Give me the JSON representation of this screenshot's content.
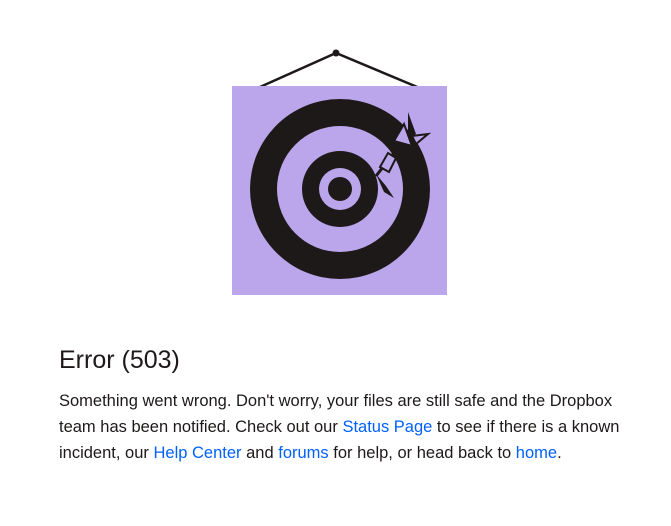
{
  "illustration": {
    "name": "hanging-target-with-dart",
    "background_color": "#bba6ec",
    "ring_color": "#1e1919"
  },
  "error": {
    "title": "Error (503)",
    "text_1": "Something went wrong. Don't worry, your files are still safe and the Dropbox team has been notified. Check out our ",
    "status_page_link": "Status Page",
    "text_2": " to see if there is a known incident, our ",
    "help_center_link": "Help Center",
    "text_3": " and ",
    "forums_link": "forums",
    "text_4": " for help, or head back to ",
    "home_link": "home",
    "text_5": "."
  },
  "colors": {
    "text": "#1e1919",
    "link": "#0061fe"
  }
}
